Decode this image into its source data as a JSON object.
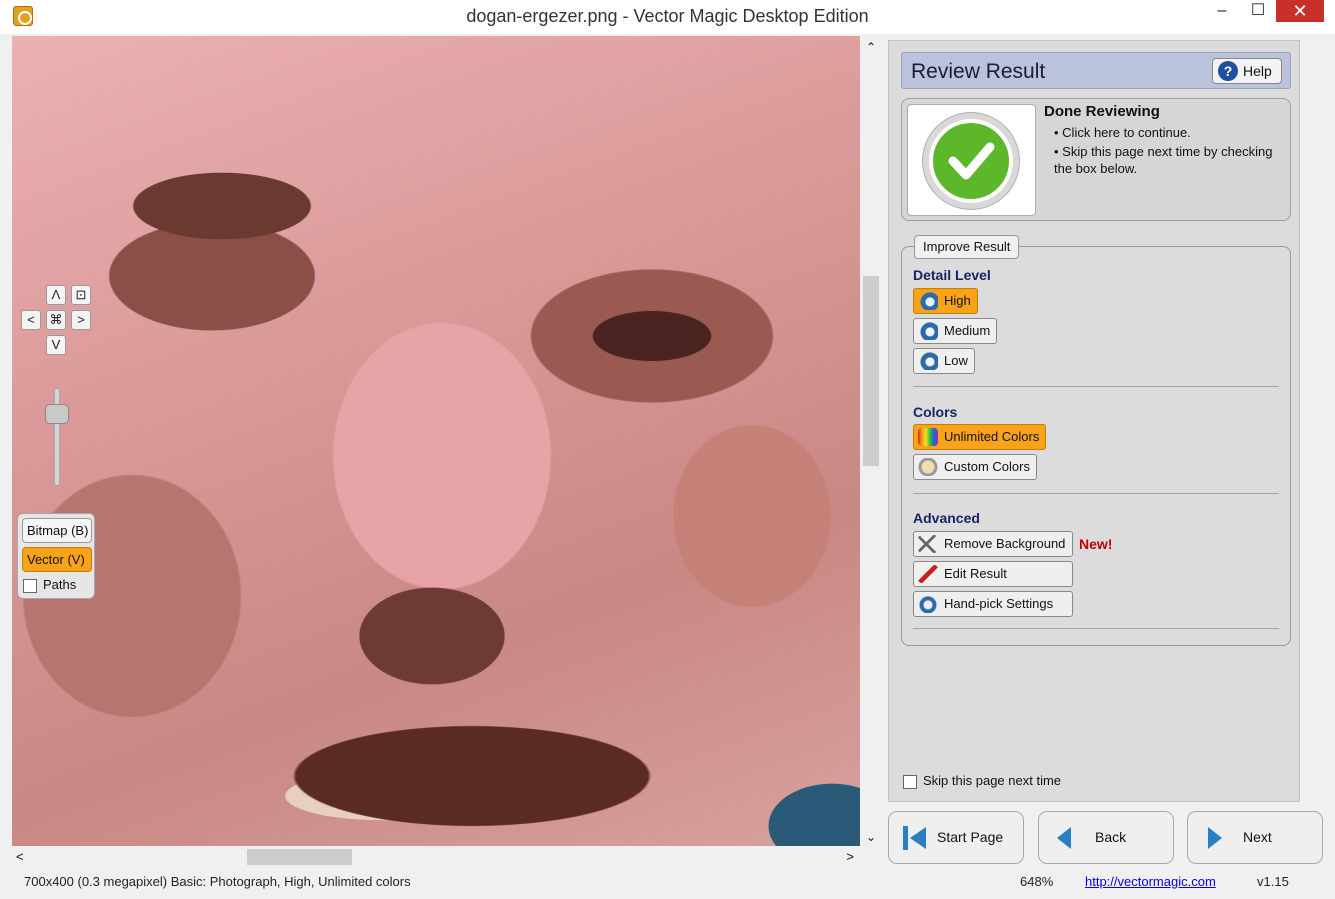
{
  "window": {
    "title": "dogan-ergezer.png - Vector Magic Desktop Edition",
    "minimize": "‒",
    "maximize": "☐",
    "close": "✕"
  },
  "viewer": {
    "nav": {
      "up": "Λ",
      "left": "<",
      "right": ">",
      "down": "V"
    },
    "zoom_level": 0.8,
    "bitmap_label": "Bitmap (B)",
    "vector_label": "Vector (V)",
    "paths_label": "Paths",
    "selected_view": "vector"
  },
  "scroll": {
    "up": "⌃",
    "down": "⌄",
    "left": "<",
    "right": ">"
  },
  "status": {
    "info": "700x400 (0.3 megapixel)  Basic: Photograph, High, Unlimited colors",
    "zoom": "648%",
    "link": "http://vectormagic.com",
    "version": "v1.15"
  },
  "panel": {
    "title": "Review Result",
    "help": "Help",
    "help_icon": "?",
    "done": {
      "title": "Done Reviewing",
      "bullet1": "• Click here to continue.",
      "bullet2": "• Skip this page next time by checking the box below."
    },
    "improve_tab": "Improve Result",
    "detail": {
      "title": "Detail Level",
      "high": "High",
      "medium": "Medium",
      "low": "Low",
      "selected": "High"
    },
    "colors": {
      "title": "Colors",
      "unlimited": "Unlimited Colors",
      "custom": "Custom Colors",
      "selected": "Unlimited Colors"
    },
    "advanced": {
      "title": "Advanced",
      "remove_bg": "Remove Background",
      "new_label": "New!",
      "edit": "Edit Result",
      "handpick": "Hand-pick Settings"
    },
    "skip_label": "Skip this page next time"
  },
  "footer": {
    "start": "Start Page",
    "back": "Back",
    "next": "Next"
  },
  "colors": {
    "accent": "#f9a31b",
    "header": "#bbc3dc",
    "check_green": "#5cb82a",
    "new_red": "#c00000",
    "close_red": "#c7312a"
  }
}
